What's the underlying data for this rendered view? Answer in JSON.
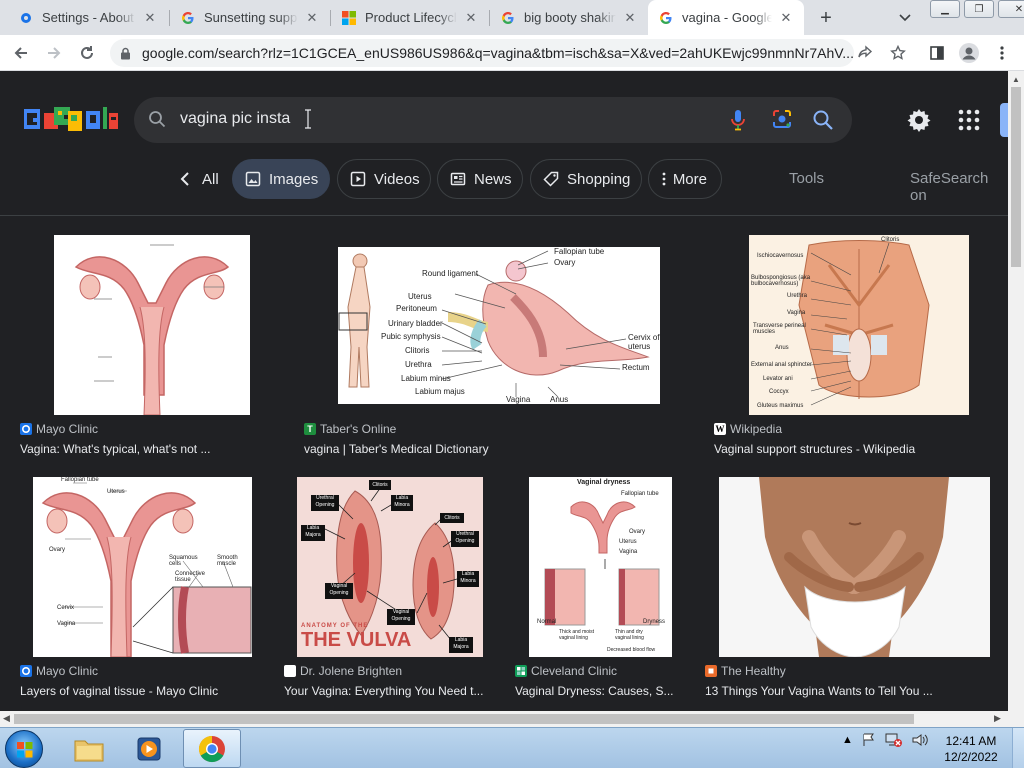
{
  "tabs": [
    {
      "title": "Settings - About Chrome",
      "icon": "gear-icon",
      "active": false
    },
    {
      "title": "Sunsetting support for",
      "icon": "google-icon",
      "active": false
    },
    {
      "title": "Product Lifecycle",
      "icon": "microsoft-icon",
      "active": false
    },
    {
      "title": "big booty shaking",
      "icon": "google-icon",
      "active": false
    },
    {
      "title": "vagina - Google Search",
      "icon": "google-icon",
      "active": true
    }
  ],
  "address": {
    "url": "google.com/search?rlz=1C1GCEA_enUS986US986&q=vagina&tbm=isch&sa=X&ved=2ahUKEwjc99nmnNr7AhV..."
  },
  "search": {
    "query": "vagina pic insta"
  },
  "chips": {
    "all": "All",
    "images": "Images",
    "videos": "Videos",
    "news": "News",
    "shopping": "Shopping",
    "more": "More",
    "tools": "Tools",
    "safesearch": "SafeSearch on"
  },
  "results": [
    {
      "source": "Mayo Clinic",
      "caption": "Vagina: What's typical, what's not ...",
      "fav_color": "#1a73e8"
    },
    {
      "source": "Taber's Online",
      "caption": "vagina | Taber's Medical Dictionary",
      "fav_color": "#1e8e3e",
      "fav_letter": "T"
    },
    {
      "source": "Wikipedia",
      "caption": "Vaginal support structures - Wikipedia",
      "fav_color": "#ffffff",
      "fav_letter": "W"
    },
    {
      "source": "Mayo Clinic",
      "caption": "Layers of vaginal tissue - Mayo Clinic",
      "fav_color": "#1a73e8"
    },
    {
      "source": "Dr. Jolene Brighten",
      "caption": "Your Vagina: Everything You Need t...",
      "fav_color": "#ffffff"
    },
    {
      "source": "Cleveland Clinic",
      "caption": "Vaginal Dryness: Causes, S...",
      "fav_color": "#0f9d58"
    },
    {
      "source": "The Healthy",
      "caption": "13 Things Your Vagina Wants to Tell You ...",
      "fav_color": "#ea6a2a"
    }
  ],
  "taskbar": {
    "time": "12:41 AM",
    "date": "12/2/2022"
  }
}
